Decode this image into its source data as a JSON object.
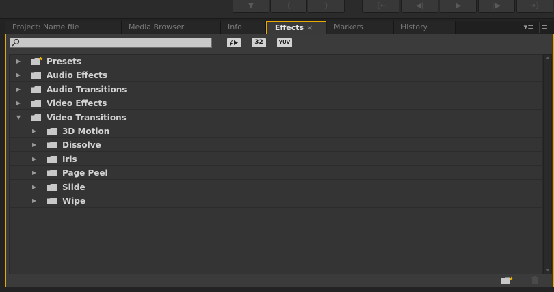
{
  "tabs": [
    {
      "label": "Project: Name file",
      "active": false
    },
    {
      "label": "Media Browser",
      "active": false
    },
    {
      "label": "Info",
      "active": false
    },
    {
      "label": "Effects",
      "active": true
    },
    {
      "label": "Markers",
      "active": false
    },
    {
      "label": "History",
      "active": false
    }
  ],
  "search": {
    "value": "",
    "placeholder": ""
  },
  "filter_buttons": {
    "accelerated": "",
    "bit32": "32",
    "yuv": "YUV"
  },
  "tree": [
    {
      "label": "Presets",
      "level": 0,
      "expanded": false,
      "icon": "preset-folder-icon"
    },
    {
      "label": "Audio Effects",
      "level": 0,
      "expanded": false,
      "icon": "folder-icon"
    },
    {
      "label": "Audio Transitions",
      "level": 0,
      "expanded": false,
      "icon": "folder-icon"
    },
    {
      "label": "Video Effects",
      "level": 0,
      "expanded": false,
      "icon": "folder-icon"
    },
    {
      "label": "Video Transitions",
      "level": 0,
      "expanded": true,
      "icon": "folder-icon"
    },
    {
      "label": "3D Motion",
      "level": 1,
      "expanded": false,
      "icon": "folder-icon"
    },
    {
      "label": "Dissolve",
      "level": 1,
      "expanded": false,
      "icon": "folder-icon"
    },
    {
      "label": "Iris",
      "level": 1,
      "expanded": false,
      "icon": "folder-icon"
    },
    {
      "label": "Page Peel",
      "level": 1,
      "expanded": false,
      "icon": "folder-icon"
    },
    {
      "label": "Slide",
      "level": 1,
      "expanded": false,
      "icon": "folder-icon"
    },
    {
      "label": "Wipe",
      "level": 1,
      "expanded": false,
      "icon": "folder-icon"
    }
  ],
  "colors": {
    "accent": "#e8a900",
    "panel_bg": "#3b3b3b",
    "preset_star": "#f0b400"
  }
}
